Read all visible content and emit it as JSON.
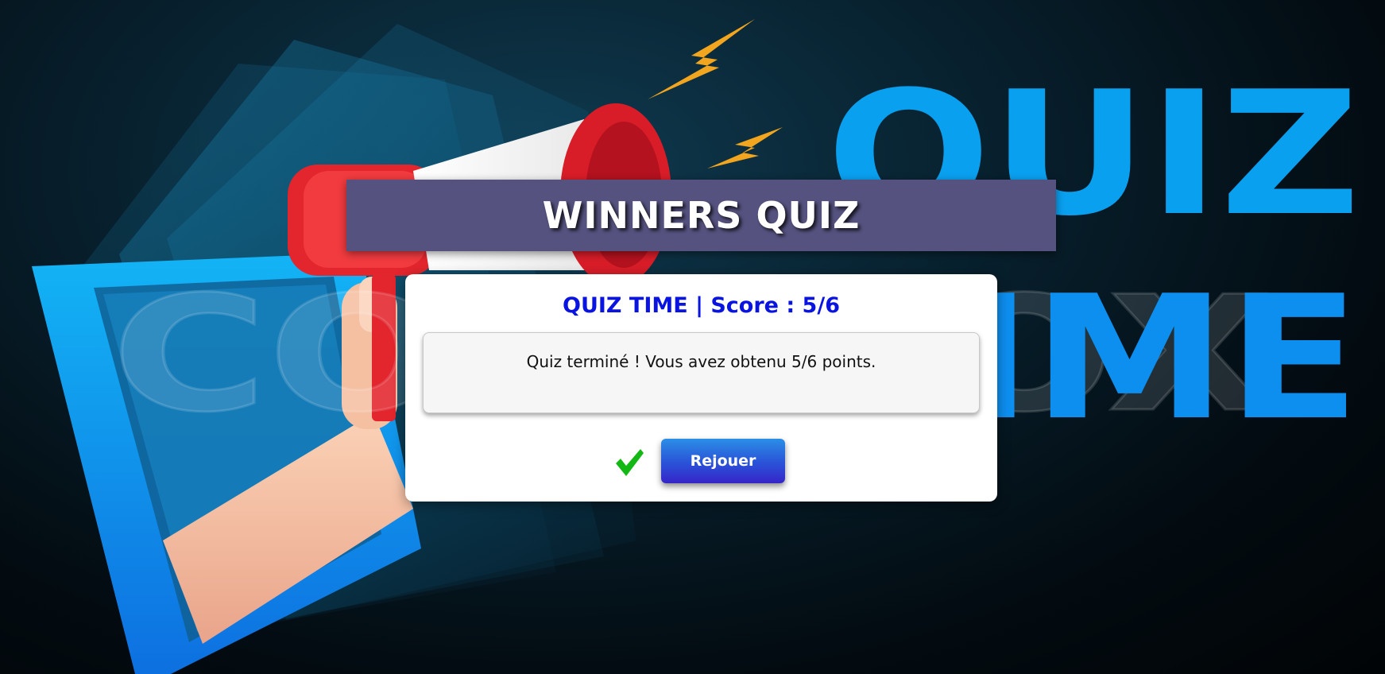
{
  "background": {
    "quiz_word": "QUIZ",
    "time_word": "TIME",
    "watermark_word": "CODEBOX"
  },
  "header": {
    "title": "WINNERS QUIZ"
  },
  "result_card": {
    "score_line": "QUIZ TIME | Score : 5/6",
    "message": "Quiz terminé ! Vous avez obtenu 5/6 points.",
    "replay_label": "Rejouer",
    "status_icon": "checkmark-icon"
  },
  "colors": {
    "header_bg": "#55527f",
    "score_text": "#0a14e0",
    "button_gradient_top": "#2b8fe6",
    "button_gradient_bottom": "#3525c8",
    "check_green": "#14b814",
    "bg_accent_blue": "#0aa0f0"
  }
}
